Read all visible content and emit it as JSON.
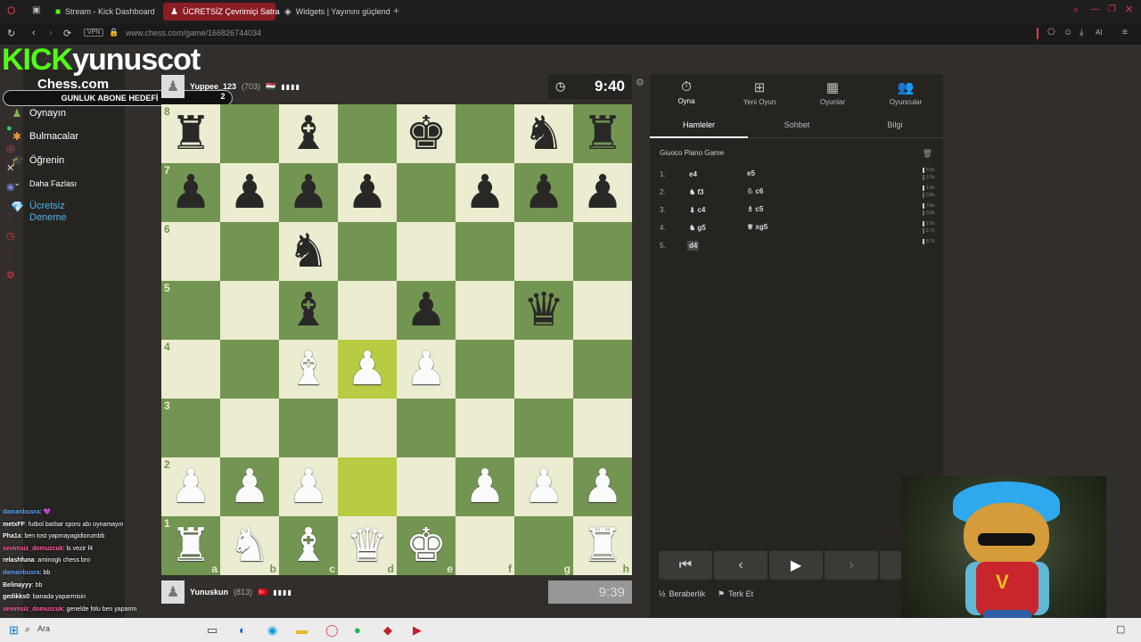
{
  "browser": {
    "tabs": [
      {
        "label": "Stream - Kick Dashboard",
        "icon": "kick-icon"
      },
      {
        "label": "ÜCRETSİZ Çevrimiçi Satra",
        "icon": "pawn-icon"
      },
      {
        "label": "Widgets | Yayınını güçlend",
        "icon": "widget-icon"
      }
    ],
    "vpn": "VPN",
    "url": "www.chess.com/game/166826744034",
    "ai": "AI"
  },
  "overlay": {
    "brand": "KICK",
    "streamer": "yunuscot",
    "goal_label": "GUNLUK ABONE HEDEFİ",
    "goal_count": "2"
  },
  "site": {
    "logo": "Chess.com",
    "nav": [
      {
        "label": "Oynayın",
        "icon": "pawn-icon"
      },
      {
        "label": "Bulmacalar",
        "icon": "puzzle-icon"
      },
      {
        "label": "Öğrenin",
        "icon": "learn-icon"
      },
      {
        "label": "Daha Fazlası",
        "icon": "chevron-down-icon"
      },
      {
        "label": "Ücretsiz Deneme",
        "icon": "diamond-icon"
      }
    ]
  },
  "game": {
    "top_player": {
      "name": "Yuppee_123",
      "rating": "(703)",
      "flags": "🇭🇺"
    },
    "bottom_player": {
      "name": "Yunuskun",
      "rating": "(813)",
      "flags": "🇹🇷"
    },
    "top_clock": "9:40",
    "bottom_clock": "9:39",
    "board": [
      [
        "bR",
        "",
        "bB",
        "",
        "bK",
        "",
        "bN",
        "bR"
      ],
      [
        "bP",
        "bP",
        "bP",
        "bP",
        "",
        "bP",
        "bP",
        "bP"
      ],
      [
        "",
        "",
        "bN",
        "",
        "",
        "",
        "",
        ""
      ],
      [
        "",
        "",
        "bB",
        "",
        "bP",
        "",
        "bQ",
        ""
      ],
      [
        "",
        "",
        "wB",
        "wP",
        "wP",
        "",
        "",
        ""
      ],
      [
        "",
        "",
        "",
        "",
        "",
        "",
        "",
        ""
      ],
      [
        "wP",
        "wP",
        "wP",
        "",
        "",
        "wP",
        "wP",
        "wP"
      ],
      [
        "wR",
        "wN",
        "wB",
        "wQ",
        "wK",
        "",
        "",
        "wR"
      ]
    ],
    "highlights": [
      "d4",
      "d2"
    ],
    "ranks": [
      "8",
      "7",
      "6",
      "5",
      "4",
      "3",
      "2",
      "1"
    ],
    "files": [
      "a",
      "b",
      "c",
      "d",
      "e",
      "f",
      "g",
      "h"
    ]
  },
  "panel": {
    "tabs": [
      {
        "label": "Oyna",
        "icon": "stopwatch-icon"
      },
      {
        "label": "Yeni Oyun",
        "icon": "plus-icon"
      },
      {
        "label": "Oyunlar",
        "icon": "board-icon"
      },
      {
        "label": "Oyuncular",
        "icon": "players-icon"
      }
    ],
    "subtabs": [
      "Hamleler",
      "Sohbet",
      "Bilgi"
    ],
    "opening": "Giuoco Piano Game",
    "moves": [
      {
        "n": "1.",
        "w": "e4",
        "b": "e5",
        "t1": "6.0s",
        "t2": "2.0s"
      },
      {
        "n": "2.",
        "w": "♞ f3",
        "b": "♘ c6",
        "t1": "1.0s",
        "t2": "0.8s"
      },
      {
        "n": "3.",
        "w": "♝ c4",
        "b": "♗ c5",
        "t1": "3.8s",
        "t2": "0.9s"
      },
      {
        "n": "4.",
        "w": "♞ g5",
        "b": "♕ xg5",
        "t1": "2.9s",
        "t2": "2.7s"
      },
      {
        "n": "5.",
        "w": "d4",
        "b": "",
        "t1": "6.7s",
        "t2": ""
      }
    ],
    "draw": "Beraberlik",
    "resign": "Terk Et"
  },
  "chat": [
    {
      "user": "damanbusra",
      "text": ": 💜",
      "color": "#5fa8ff"
    },
    {
      "user": "metxFF",
      "text": ": futbol barbar sporu abı oynamayın",
      "color": "#ffffff"
    },
    {
      "user": "Pha1x",
      "text": ": ben tost yapmayagidiorumbb",
      "color": "#ffffff"
    },
    {
      "user": "sevimsiz_domuzcuk",
      "text": ": ls vezir f4",
      "color": "#ff5fa8"
    },
    {
      "user": "relashfuna",
      "text": ": aminoglı chess bro",
      "color": "#ffffff"
    },
    {
      "user": "damanbusra",
      "text": ": bb",
      "color": "#5fa8ff"
    },
    {
      "user": "Belinayyy",
      "text": ": bb",
      "color": "#ffffff"
    },
    {
      "user": "gedikks0",
      "text": ": banada yaparmisin",
      "color": "#ffffff"
    },
    {
      "user": "sevimsiz_domuzcuk",
      "text": ": genelde folu ben yaparim",
      "color": "#ff5fa8"
    }
  ],
  "taskbar": {
    "search": "Ara"
  }
}
